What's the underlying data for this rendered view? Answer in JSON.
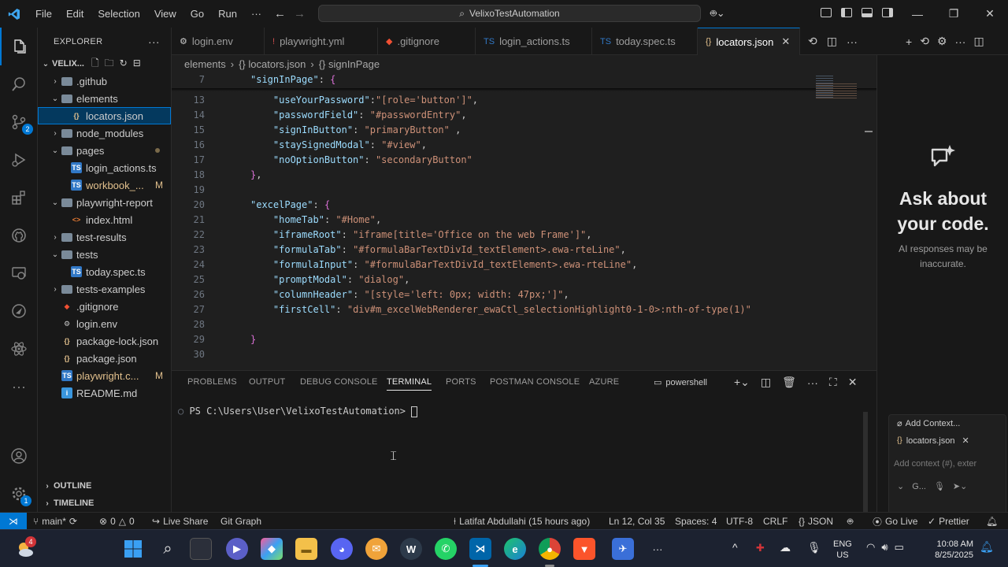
{
  "titlebar": {
    "menus": [
      "File",
      "Edit",
      "Selection",
      "View",
      "Go",
      "Run"
    ],
    "more": "···",
    "search": "VelixoTestAutomation"
  },
  "activity": {
    "scm_badge": "2",
    "settings_badge": "1"
  },
  "sidebar": {
    "title": "EXPLORER",
    "root": "VELIX...",
    "items": [
      {
        "label": ".github",
        "kind": "folder",
        "chev": "›"
      },
      {
        "label": "elements",
        "kind": "folder",
        "chev": "⌄"
      },
      {
        "label": "locators.json",
        "kind": "json"
      },
      {
        "label": "node_modules",
        "kind": "folder",
        "chev": "›"
      },
      {
        "label": "pages",
        "kind": "folder",
        "chev": "⌄"
      },
      {
        "label": "login_actions.ts",
        "kind": "ts"
      },
      {
        "label": "workbook_...",
        "kind": "ts",
        "status": "M"
      },
      {
        "label": "playwright-report",
        "kind": "folder",
        "chev": "⌄"
      },
      {
        "label": "index.html",
        "kind": "html"
      },
      {
        "label": "test-results",
        "kind": "folder",
        "chev": "›"
      },
      {
        "label": "tests",
        "kind": "folder",
        "chev": "⌄"
      },
      {
        "label": "today.spec.ts",
        "kind": "ts"
      },
      {
        "label": "tests-examples",
        "kind": "folder",
        "chev": "›"
      },
      {
        "label": ".gitignore",
        "kind": "git"
      },
      {
        "label": "login.env",
        "kind": "env"
      },
      {
        "label": "package-lock.json",
        "kind": "json"
      },
      {
        "label": "package.json",
        "kind": "json"
      },
      {
        "label": "playwright.c...",
        "kind": "ts",
        "status": "M"
      },
      {
        "label": "README.md",
        "kind": "info"
      }
    ],
    "outline": "OUTLINE",
    "timeline": "TIMELINE"
  },
  "tabs": [
    {
      "label": "login.env",
      "icon": "⚙"
    },
    {
      "label": "playwright.yml",
      "icon": "!"
    },
    {
      "label": ".gitignore",
      "icon": "◆"
    },
    {
      "label": "login_actions.ts",
      "icon": "TS"
    },
    {
      "label": "today.spec.ts",
      "icon": "TS"
    },
    {
      "label": "locators.json",
      "icon": "{}",
      "active": true
    }
  ],
  "breadcrumb": [
    "elements",
    "{} locators.json",
    "{} signInPage"
  ],
  "editor": {
    "lines": [
      {
        "n": "7",
        "html": "<span class='k'>\"signInPage\"</span>: <span class='br'>{</span>"
      },
      {
        "n": "13",
        "html": "    <span class='k'>\"useYourPassword\"</span>:<span class='s'>\"[role='button']\"</span>,"
      },
      {
        "n": "14",
        "html": "    <span class='k'>\"passwordField\"</span>: <span class='s'>\"#passwordEntry\"</span>,"
      },
      {
        "n": "15",
        "html": "    <span class='k'>\"signInButton\"</span>: <span class='s'>\"primaryButton\"</span> ,"
      },
      {
        "n": "16",
        "html": "    <span class='k'>\"staySignedModal\"</span>: <span class='s'>\"#view\"</span>,"
      },
      {
        "n": "17",
        "html": "    <span class='k'>\"noOptionButton\"</span>: <span class='s'>\"secondaryButton\"</span>"
      },
      {
        "n": "18",
        "html": "<span class='br'>}</span>,"
      },
      {
        "n": "19",
        "html": ""
      },
      {
        "n": "20",
        "html": "<span class='k'>\"excelPage\"</span>: <span class='br'>{</span>"
      },
      {
        "n": "21",
        "html": "    <span class='k'>\"homeTab\"</span>: <span class='s'>\"#Home\"</span>,"
      },
      {
        "n": "22",
        "html": "    <span class='k'>\"iframeRoot\"</span>: <span class='s'>\"iframe[title='Office on the web Frame']\"</span>,"
      },
      {
        "n": "23",
        "html": "    <span class='k'>\"formulaTab\"</span>: <span class='s'>\"#formulaBarTextDivId_textElement&gt;.ewa-rteLine\"</span>,"
      },
      {
        "n": "24",
        "html": "    <span class='k'>\"formulaInput\"</span>: <span class='s'>\"#formulaBarTextDivId_textElement&gt;.ewa-rteLine\"</span>,"
      },
      {
        "n": "25",
        "html": "    <span class='k'>\"promptModal\"</span>: <span class='s'>\"dialog\"</span>,"
      },
      {
        "n": "26",
        "html": "    <span class='k'>\"columnHeader\"</span>: <span class='s'>\"[style='left: 0px; width: 47px;']\"</span>,"
      },
      {
        "n": "27",
        "html": "    <span class='k'>\"firstCell\"</span>: <span class='s'>\"div#m_excelWebRenderer_ewaCtl_selectionHighlight0-1-0&gt;:nth-of-type(1)\"</span>"
      },
      {
        "n": "28",
        "html": ""
      },
      {
        "n": "29",
        "html": "<span class='br'>}</span>"
      },
      {
        "n": "30",
        "html": ""
      }
    ]
  },
  "chat": {
    "heading": "Ask about your code.",
    "subtitle": "AI responses may be inaccurate.",
    "add_context": "Add Context...",
    "context_file": "locators.json",
    "placeholder": "Add context (#), exter",
    "model": "G..."
  },
  "panel": {
    "tabs": [
      "PROBLEMS",
      "OUTPUT",
      "DEBUG CONSOLE",
      "TERMINAL",
      "PORTS",
      "POSTMAN CONSOLE",
      "AZURE"
    ],
    "active_tab": "TERMINAL",
    "shell": "powershell",
    "prompt": "PS C:\\Users\\User\\VelixoTestAutomation> "
  },
  "status": {
    "branch": "main*",
    "errors": "0",
    "warnings": "0",
    "live_share": "Live Share",
    "git_graph": "Git Graph",
    "blame": "Latifat Abdullahi (15 hours ago)",
    "position": "Ln 12, Col 35",
    "spaces": "Spaces: 4",
    "encoding": "UTF-8",
    "eol": "CRLF",
    "language": "JSON",
    "go_live": "Go Live",
    "prettier": "Prettier"
  },
  "taskbar": {
    "weather_badge": "4",
    "lang_top": "ENG",
    "lang_bottom": "US",
    "time": "10:08 AM",
    "date": "8/25/2025"
  },
  "colors": {
    "accent": "#0078d4",
    "bg_editor": "#1f1f1f",
    "bg_chrome": "#181818"
  }
}
